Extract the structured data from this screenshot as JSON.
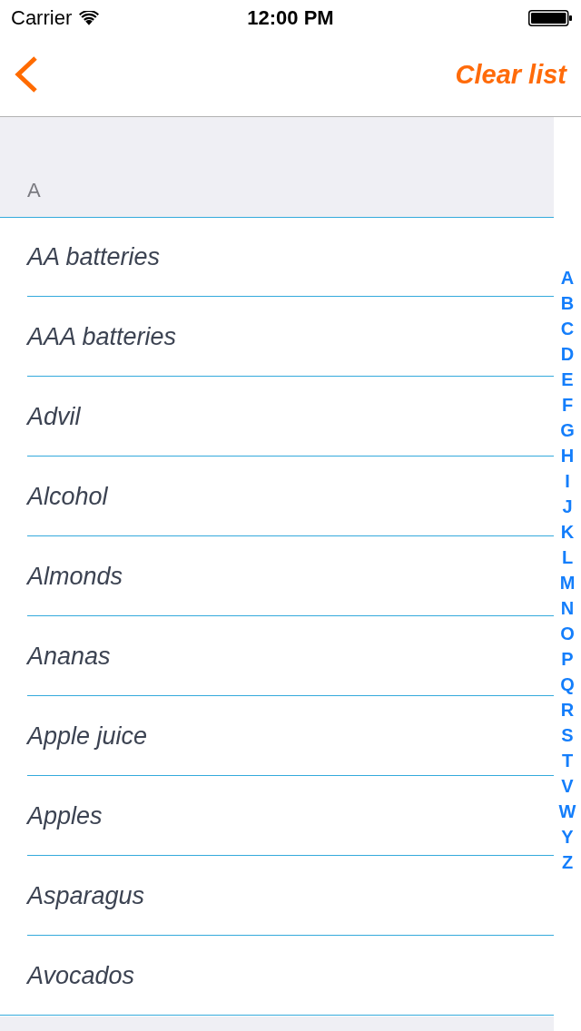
{
  "status_bar": {
    "carrier": "Carrier",
    "time": "12:00 PM"
  },
  "nav_bar": {
    "action": "Clear list"
  },
  "sections": [
    {
      "title": "A",
      "items": [
        "AA batteries",
        "AAA batteries",
        "Advil",
        "Alcohol",
        "Almonds",
        "Ananas",
        "Apple juice",
        "Apples",
        "Asparagus",
        "Avocados"
      ]
    }
  ],
  "index": [
    "A",
    "B",
    "C",
    "D",
    "E",
    "F",
    "G",
    "H",
    "I",
    "J",
    "K",
    "L",
    "M",
    "N",
    "O",
    "P",
    "Q",
    "R",
    "S",
    "T",
    "V",
    "W",
    "Y",
    "Z"
  ]
}
